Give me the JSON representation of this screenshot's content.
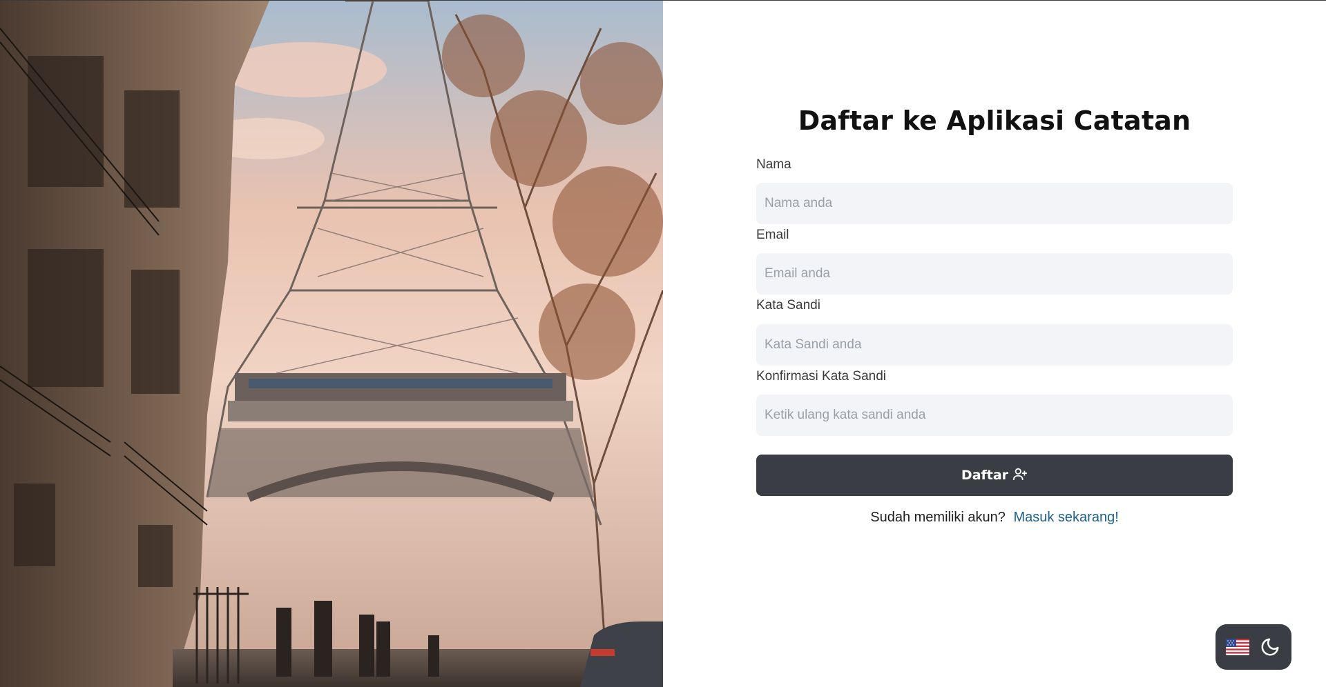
{
  "form": {
    "title": "Daftar ke Aplikasi Catatan",
    "fields": [
      {
        "label": "Nama",
        "placeholder": "Nama anda",
        "value": ""
      },
      {
        "label": "Email",
        "placeholder": "Email anda",
        "value": ""
      },
      {
        "label": "Kata Sandi",
        "placeholder": "Kata Sandi anda",
        "value": ""
      },
      {
        "label": "Konfirmasi Kata Sandi",
        "placeholder": "Ketik ulang kata sandi anda",
        "value": ""
      }
    ],
    "submit_label": "Daftar",
    "submit_icon": "user-plus-icon",
    "login_prompt": "Sudah memiliki akun?",
    "login_link": "Masuk sekarang!"
  },
  "toggles": {
    "language_icon": "us-flag-icon",
    "theme_icon": "moon-icon"
  },
  "colors": {
    "button": "#3b3d44",
    "input_bg": "#f3f4f7",
    "link": "#1d5f8f"
  }
}
